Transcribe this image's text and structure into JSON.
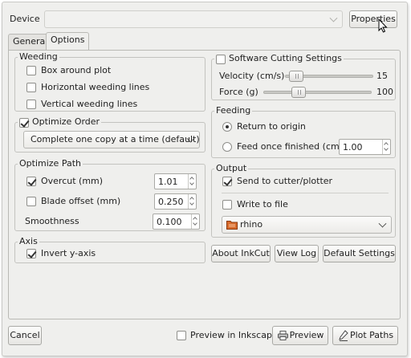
{
  "header": {
    "device_label": "Device",
    "device_value": "",
    "properties_label": "Properties"
  },
  "tabs": [
    {
      "label": "General",
      "active": false
    },
    {
      "label": "Options",
      "active": true
    }
  ],
  "weeding": {
    "title": "Weeding",
    "options": [
      {
        "label": "Box around plot",
        "checked": false
      },
      {
        "label": "Horizontal weeding lines",
        "checked": false
      },
      {
        "label": "Vertical weeding lines",
        "checked": false
      }
    ]
  },
  "optimize_order": {
    "label": "Optimize Order",
    "checked": true,
    "selected": "Complete one copy at a time (default)"
  },
  "optimize_path": {
    "title": "Optimize Path",
    "overcut_label": "Overcut (mm)",
    "overcut_checked": true,
    "overcut_value": "1.01",
    "blade_label": "Blade offset (mm)",
    "blade_checked": false,
    "blade_value": "0.250",
    "smoothness_label": "Smoothness",
    "smoothness_value": "0.100"
  },
  "axis": {
    "title": "Axis",
    "invert_label": "Invert y-axis",
    "invert_checked": true
  },
  "software_cutting": {
    "label": "Software Cutting Settings",
    "checked": false,
    "velocity_label": "Velocity (cm/s)",
    "velocity_value": "15",
    "force_label": "Force (g)",
    "force_value": "100"
  },
  "feeding": {
    "title": "Feeding",
    "return_label": "Return to origin",
    "return_selected": true,
    "feed_label": "Feed once finished (cm)",
    "feed_value": "1.00"
  },
  "output": {
    "title": "Output",
    "send_label": "Send to cutter/plotter",
    "send_checked": true,
    "write_label": "Write to file",
    "write_checked": false,
    "file_value": "rhino"
  },
  "buttons": {
    "about": "About InkCut",
    "view_log": "View Log",
    "default_settings": "Default Settings",
    "cancel": "Cancel",
    "preview_inkscape": "Preview in Inkscape",
    "preview": "Preview",
    "plot_paths": "Plot Paths"
  },
  "colors": {
    "window_bg": "#efefed",
    "folder_icon": "#d86a2a"
  }
}
